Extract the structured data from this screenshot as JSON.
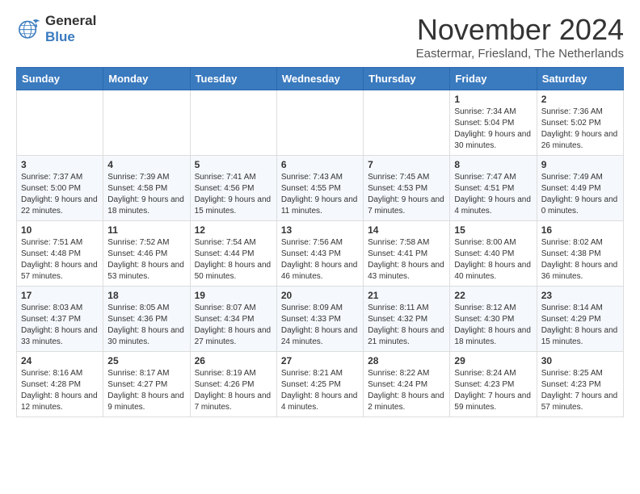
{
  "logo": {
    "line1": "General",
    "line2": "Blue"
  },
  "title": "November 2024",
  "subtitle": "Eastermar, Friesland, The Netherlands",
  "days_header": [
    "Sunday",
    "Monday",
    "Tuesday",
    "Wednesday",
    "Thursday",
    "Friday",
    "Saturday"
  ],
  "weeks": [
    [
      {
        "day": "",
        "info": ""
      },
      {
        "day": "",
        "info": ""
      },
      {
        "day": "",
        "info": ""
      },
      {
        "day": "",
        "info": ""
      },
      {
        "day": "",
        "info": ""
      },
      {
        "day": "1",
        "info": "Sunrise: 7:34 AM\nSunset: 5:04 PM\nDaylight: 9 hours and 30 minutes."
      },
      {
        "day": "2",
        "info": "Sunrise: 7:36 AM\nSunset: 5:02 PM\nDaylight: 9 hours and 26 minutes."
      }
    ],
    [
      {
        "day": "3",
        "info": "Sunrise: 7:37 AM\nSunset: 5:00 PM\nDaylight: 9 hours and 22 minutes."
      },
      {
        "day": "4",
        "info": "Sunrise: 7:39 AM\nSunset: 4:58 PM\nDaylight: 9 hours and 18 minutes."
      },
      {
        "day": "5",
        "info": "Sunrise: 7:41 AM\nSunset: 4:56 PM\nDaylight: 9 hours and 15 minutes."
      },
      {
        "day": "6",
        "info": "Sunrise: 7:43 AM\nSunset: 4:55 PM\nDaylight: 9 hours and 11 minutes."
      },
      {
        "day": "7",
        "info": "Sunrise: 7:45 AM\nSunset: 4:53 PM\nDaylight: 9 hours and 7 minutes."
      },
      {
        "day": "8",
        "info": "Sunrise: 7:47 AM\nSunset: 4:51 PM\nDaylight: 9 hours and 4 minutes."
      },
      {
        "day": "9",
        "info": "Sunrise: 7:49 AM\nSunset: 4:49 PM\nDaylight: 9 hours and 0 minutes."
      }
    ],
    [
      {
        "day": "10",
        "info": "Sunrise: 7:51 AM\nSunset: 4:48 PM\nDaylight: 8 hours and 57 minutes."
      },
      {
        "day": "11",
        "info": "Sunrise: 7:52 AM\nSunset: 4:46 PM\nDaylight: 8 hours and 53 minutes."
      },
      {
        "day": "12",
        "info": "Sunrise: 7:54 AM\nSunset: 4:44 PM\nDaylight: 8 hours and 50 minutes."
      },
      {
        "day": "13",
        "info": "Sunrise: 7:56 AM\nSunset: 4:43 PM\nDaylight: 8 hours and 46 minutes."
      },
      {
        "day": "14",
        "info": "Sunrise: 7:58 AM\nSunset: 4:41 PM\nDaylight: 8 hours and 43 minutes."
      },
      {
        "day": "15",
        "info": "Sunrise: 8:00 AM\nSunset: 4:40 PM\nDaylight: 8 hours and 40 minutes."
      },
      {
        "day": "16",
        "info": "Sunrise: 8:02 AM\nSunset: 4:38 PM\nDaylight: 8 hours and 36 minutes."
      }
    ],
    [
      {
        "day": "17",
        "info": "Sunrise: 8:03 AM\nSunset: 4:37 PM\nDaylight: 8 hours and 33 minutes."
      },
      {
        "day": "18",
        "info": "Sunrise: 8:05 AM\nSunset: 4:36 PM\nDaylight: 8 hours and 30 minutes."
      },
      {
        "day": "19",
        "info": "Sunrise: 8:07 AM\nSunset: 4:34 PM\nDaylight: 8 hours and 27 minutes."
      },
      {
        "day": "20",
        "info": "Sunrise: 8:09 AM\nSunset: 4:33 PM\nDaylight: 8 hours and 24 minutes."
      },
      {
        "day": "21",
        "info": "Sunrise: 8:11 AM\nSunset: 4:32 PM\nDaylight: 8 hours and 21 minutes."
      },
      {
        "day": "22",
        "info": "Sunrise: 8:12 AM\nSunset: 4:30 PM\nDaylight: 8 hours and 18 minutes."
      },
      {
        "day": "23",
        "info": "Sunrise: 8:14 AM\nSunset: 4:29 PM\nDaylight: 8 hours and 15 minutes."
      }
    ],
    [
      {
        "day": "24",
        "info": "Sunrise: 8:16 AM\nSunset: 4:28 PM\nDaylight: 8 hours and 12 minutes."
      },
      {
        "day": "25",
        "info": "Sunrise: 8:17 AM\nSunset: 4:27 PM\nDaylight: 8 hours and 9 minutes."
      },
      {
        "day": "26",
        "info": "Sunrise: 8:19 AM\nSunset: 4:26 PM\nDaylight: 8 hours and 7 minutes."
      },
      {
        "day": "27",
        "info": "Sunrise: 8:21 AM\nSunset: 4:25 PM\nDaylight: 8 hours and 4 minutes."
      },
      {
        "day": "28",
        "info": "Sunrise: 8:22 AM\nSunset: 4:24 PM\nDaylight: 8 hours and 2 minutes."
      },
      {
        "day": "29",
        "info": "Sunrise: 8:24 AM\nSunset: 4:23 PM\nDaylight: 7 hours and 59 minutes."
      },
      {
        "day": "30",
        "info": "Sunrise: 8:25 AM\nSunset: 4:23 PM\nDaylight: 7 hours and 57 minutes."
      }
    ]
  ]
}
